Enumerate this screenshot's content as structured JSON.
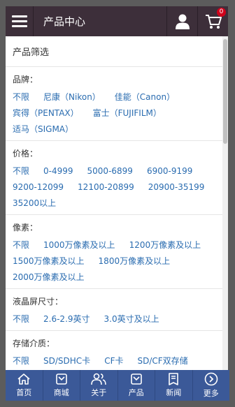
{
  "header": {
    "title": "产品中心",
    "cart_count": "0",
    "menu_icon": "hamburger-icon",
    "user_icon": "user-icon",
    "cart_icon": "cart-icon"
  },
  "filter": {
    "heading": "产品筛选",
    "groups": [
      {
        "label": "品牌：",
        "options": [
          "不限",
          "尼康（Nikon）",
          "佳能（Canon）",
          "宾得（PENTAX）",
          "富士（FUJIFILM）",
          "适马（SIGMA）"
        ]
      },
      {
        "label": "价格：",
        "options": [
          "不限",
          "0-4999",
          "5000-6899",
          "6900-9199",
          "9200-12099",
          "12100-20899",
          "20900-35199",
          "35200以上"
        ]
      },
      {
        "label": "像素：",
        "options": [
          "不限",
          "1000万像素及以上",
          "1200万像素及以上",
          "1500万像素及以上",
          "1800万像素及以上",
          "2000万像素及以上"
        ]
      },
      {
        "label": "液晶屏尺寸：",
        "options": [
          "不限",
          "2.6-2.9英寸",
          "3.0英寸及以上"
        ]
      },
      {
        "label": "存储介质：",
        "options": [
          "不限",
          "SD/SDHC卡",
          "CF卡",
          "SD/CF双存储"
        ]
      }
    ]
  },
  "nav": {
    "items": [
      {
        "label": "首页",
        "icon": "home-icon"
      },
      {
        "label": "商城",
        "icon": "mall-icon"
      },
      {
        "label": "关于",
        "icon": "people-icon"
      },
      {
        "label": "产品",
        "icon": "product-icon"
      },
      {
        "label": "新闻",
        "icon": "news-icon"
      },
      {
        "label": "更多",
        "icon": "more-icon"
      }
    ]
  },
  "colors": {
    "header_bg": "#3d2f3a",
    "nav_bg": "#3b5998",
    "link": "#2a6cb0",
    "badge": "#d0021b"
  }
}
